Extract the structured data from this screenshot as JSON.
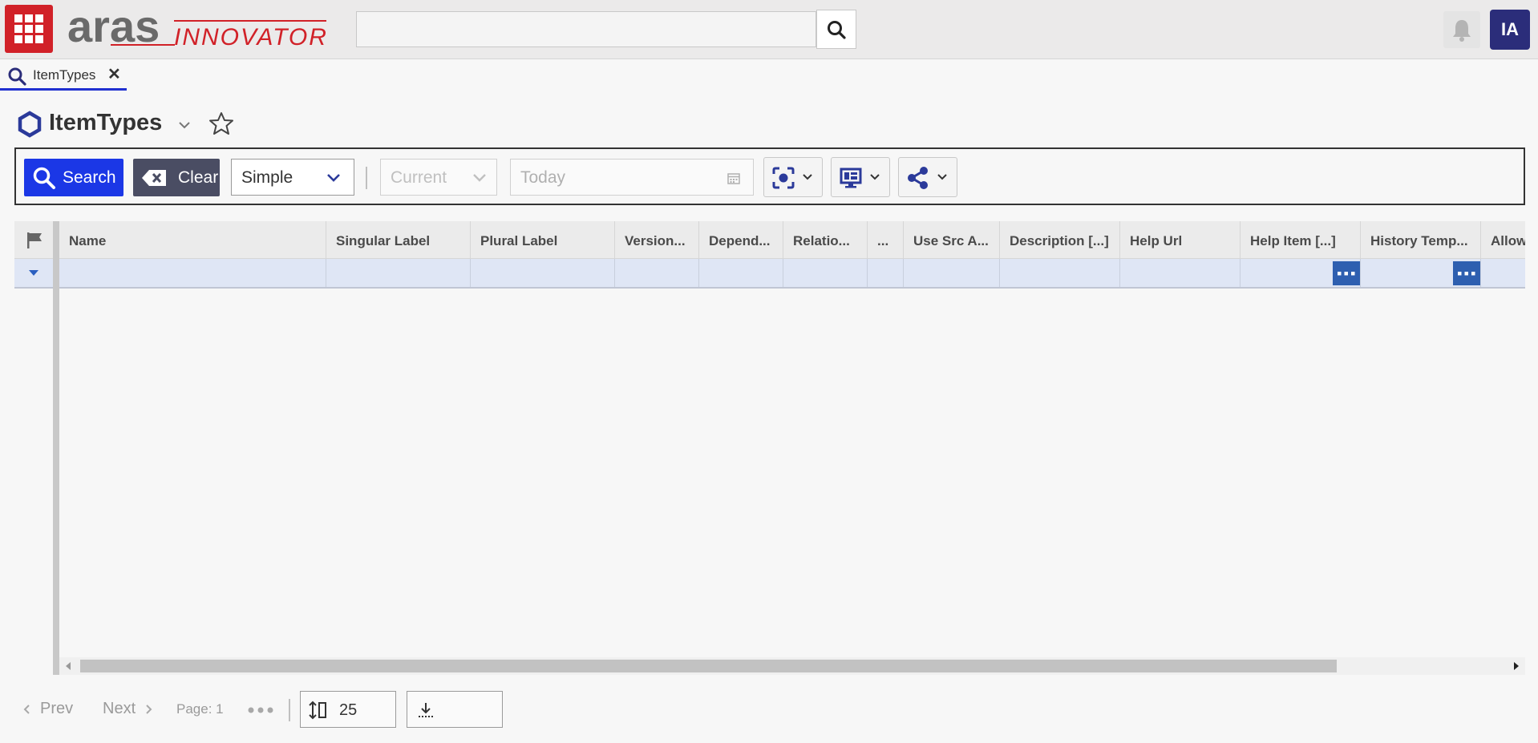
{
  "header": {
    "logo_aras": "aras",
    "logo_innovator": "INNOVATOR",
    "search_value": "",
    "user_initials": "IA"
  },
  "tab": {
    "label": "ItemTypes",
    "close": "✕"
  },
  "page": {
    "title": "ItemTypes"
  },
  "toolbar": {
    "search_label": "Search",
    "clear_label": "Clear",
    "mode_value": "Simple",
    "date_mode_value": "Current",
    "date_placeholder": "Today"
  },
  "grid": {
    "columns": [
      "Name",
      "Singular Label",
      "Plural Label",
      "Version...",
      "Depend...",
      "Relatio...",
      "...",
      "Use Src A...",
      "Description [...]",
      "Help Url",
      "Help Item [...]",
      "History Temp...",
      "Allow"
    ]
  },
  "footer": {
    "prev": "Prev",
    "next": "Next",
    "page": "Page: 1",
    "page_size": "25"
  },
  "colors": {
    "brand_red": "#d12128",
    "primary_blue": "#1b37e6",
    "avatar_bg": "#2b2d7a",
    "filter_row": "#dfe6f5"
  }
}
